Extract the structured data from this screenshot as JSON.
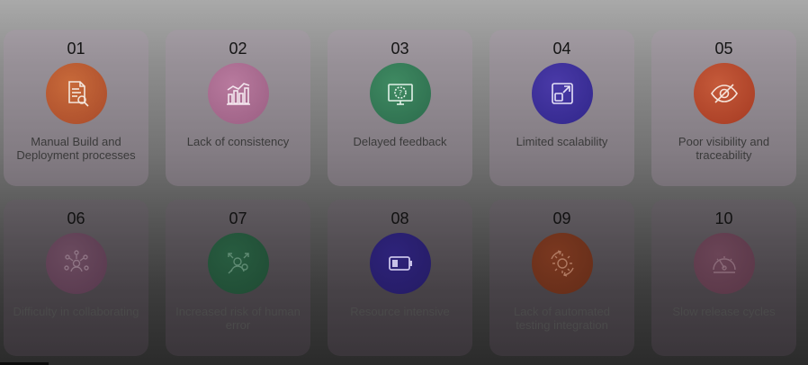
{
  "cards": [
    {
      "num": "01",
      "label": "Manual Build and Deployment processes",
      "icon": "document-search-icon"
    },
    {
      "num": "02",
      "label": "Lack of consistency",
      "icon": "bar-chart-icon"
    },
    {
      "num": "03",
      "label": "Delayed feedback",
      "icon": "monitor-question-icon"
    },
    {
      "num": "04",
      "label": "Limited scalability",
      "icon": "expand-icon"
    },
    {
      "num": "05",
      "label": "Poor visibility and traceability",
      "icon": "eye-slash-icon"
    },
    {
      "num": "06",
      "label": "Difficulty in collaborating",
      "icon": "team-network-icon"
    },
    {
      "num": "07",
      "label": "Increased risk of human error",
      "icon": "user-arrows-icon"
    },
    {
      "num": "08",
      "label": "Resource intensive",
      "icon": "battery-icon"
    },
    {
      "num": "09",
      "label": "Lack of automated testing integration",
      "icon": "gear-cycle-icon"
    },
    {
      "num": "10",
      "label": "Slow release cycles",
      "icon": "speedometer-icon"
    }
  ],
  "colors": {
    "orange": "#b85a32",
    "pink": "#aa6c90",
    "green": "#367a56",
    "blue": "#3d3098"
  }
}
